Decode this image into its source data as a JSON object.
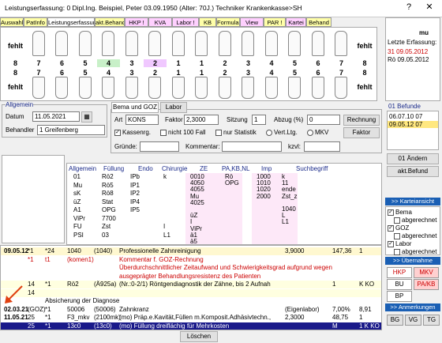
{
  "title": "Leistungserfassung: 0  Dipl.Ing. Beispiel, Peter  03.09.1950 (Alter: 70J.)  Techniker Krankenkasse>SH",
  "window": {
    "help": "?",
    "close": "✕"
  },
  "tabs": [
    "Auswahl",
    "PatInfo",
    "Leistungserfassung !",
    "akt.Behand",
    "HKP !",
    "KVA",
    "Labor !",
    "KB",
    "Formular",
    "View",
    "PAR !",
    "Kartei",
    "Behand"
  ],
  "tab_colors": [
    "#ffffa8",
    "#ffffa8",
    "#ffffff",
    "#ffffa8",
    "#ffd0ff",
    "#ffd0ff",
    "#ffd0ff",
    "#ffffa8",
    "#ffffa8",
    "#ffd0ff",
    "#ffffa8",
    "#ffd0ff",
    "#ffffa8"
  ],
  "teeth": {
    "upper": [
      "fehlt",
      "",
      "",
      "",
      "",
      "",
      "",
      "",
      "",
      "",
      "",
      "",
      "",
      "",
      "",
      "fehlt"
    ],
    "upper_nums": [
      "8",
      "7",
      "6",
      "5",
      "4",
      "3",
      "2",
      "1",
      "1",
      "2",
      "3",
      "4",
      "5",
      "6",
      "7",
      "8"
    ],
    "lower_nums": [
      "8",
      "7",
      "6",
      "5",
      "4",
      "3",
      "2",
      "1",
      "1",
      "2",
      "3",
      "4",
      "5",
      "6",
      "7",
      "8"
    ],
    "lower": [
      "fehlt",
      "",
      "",
      "",
      "",
      "",
      "",
      "",
      "",
      "",
      "",
      "",
      "",
      "",
      "",
      "fehlt"
    ]
  },
  "rightpanel": {
    "letzte": "Letzte Erfassung:",
    "d1": "31 09.05.2012",
    "d2": "Rö 09.05.2012",
    "mu": "mu"
  },
  "allgemein": {
    "title": "Allgemein",
    "datum_label": "Datum",
    "datum": "11.05.2021",
    "behandler_label": "Behandler",
    "behandler": "1 Greifenberg"
  },
  "bema": {
    "tab1": "Bema und GOZ",
    "tab2": "Labor",
    "art_label": "Art",
    "art": "KONS",
    "faktor_label": "Faktor",
    "faktor": "2,3000",
    "sitzung_label": "Sitzung",
    "sitzung": "1",
    "abzug_label": "Abzug (%)",
    "abzug": "0",
    "rechnung": "Rechnung",
    "faktor_btn": "Faktor",
    "kassenrg": "Kassenrg.",
    "nicht100": "nicht 100 Fall",
    "statistik": "nur Statistik",
    "vertltg": "Vert.Ltg.",
    "mkv": "MKV",
    "gruende_label": "Gründe:",
    "kommentar_label": "Kommentar:",
    "kzvl_label": "kzvl:"
  },
  "befunde": {
    "title": "01 Befunde",
    "items": [
      "06.07.10 07",
      "09.05.12 07"
    ],
    "aendern": "01 Ändern",
    "akt": "akt.Befund"
  },
  "grid": {
    "headers": [
      "Allgemein",
      "Füllung",
      "Endo",
      "Chirurgie",
      "ZE",
      "PA,KB,NL",
      "Imp",
      "Suchbegriff"
    ],
    "col1": [
      "01",
      "Mu",
      "sK",
      "üZ",
      "A1",
      "ViPr",
      "FU",
      "PSI"
    ],
    "col2": [
      "Rö2",
      "Rö5",
      "Rö8",
      "Stat",
      "OPG",
      "7700",
      "Zst",
      "03"
    ],
    "col3": [
      "IPb",
      "IP1",
      "IP2",
      "IP4",
      "IP5",
      "",
      "",
      ""
    ],
    "col4": [
      "k",
      "",
      "",
      "",
      "",
      "",
      "I",
      "L1"
    ],
    "col5": [
      "0010",
      "4050",
      "4055",
      "Mu",
      "4025",
      "",
      "",
      "",
      "",
      "",
      ""
    ],
    "col5b": [
      "0010",
      "4050",
      "4055",
      "Mu",
      "4025",
      "",
      "üZ",
      "I",
      "ViPr",
      "ä1",
      "ä5"
    ],
    "col6": [
      "Rö",
      "OPG",
      "",
      "",
      "",
      "",
      "",
      "",
      "",
      "",
      ""
    ],
    "col7": [
      "1000",
      "1010",
      "1020",
      "2000",
      "",
      "",
      "",
      "",
      "",
      "",
      ""
    ],
    "col8": [
      "k",
      "11",
      "ende",
      "Zst_z",
      "",
      "",
      "",
      "",
      "",
      "",
      ""
    ],
    "col8b": [
      "",
      "",
      "",
      "",
      "",
      "1040",
      "L",
      "L1",
      "",
      "",
      ""
    ]
  },
  "list": {
    "rows": [
      {
        "date": "09.05.12",
        "n": "*1",
        "code": "*24",
        "c2": "1040",
        "c3": "(1040)",
        "text": "Professionelle Zahnreinigung",
        "f": "3,9000",
        "v": "147,36",
        "k": "1",
        "color": "#000"
      },
      {
        "date": "",
        "n": "*1",
        "code": "t1",
        "c2": "(komen1)",
        "c3": "",
        "text": "Kommentar f. GOZ-Rechnung",
        "f": "",
        "v": "",
        "k": "",
        "color": "#c00"
      },
      {
        "date": "",
        "n": "",
        "code": "",
        "c2": "",
        "c3": "",
        "text": "Überdurchschnittlicher Zeitaufwand und Schwierigkeitsgrad aufgrund wegen",
        "f": "",
        "v": "",
        "k": "",
        "color": "#c00"
      },
      {
        "date": "",
        "n": "",
        "code": "",
        "c2": "",
        "c3": "",
        "text": "ausgeprägter Behandlungsresistenz des Patienten",
        "f": "",
        "v": "",
        "k": "",
        "color": "#c00"
      },
      {
        "date": "",
        "n": "14",
        "code": "*1",
        "c2": "Rö2",
        "c3": "(Ä925a)",
        "text": "(Nr.:0-2/1) Röntgendiagnostik der Zähne, bis 2 Aufnah",
        "f": "",
        "v": "1",
        "k": "K KO",
        "color": "#000"
      },
      {
        "date": "",
        "n": "14",
        "code": "",
        "c2": "",
        "c3": "",
        "text": "",
        "f": "",
        "v": "",
        "k": "",
        "color": "#000"
      },
      {
        "date": "",
        "n": "",
        "code": "Absicherung der Diagnose",
        "c2": "",
        "c3": "",
        "text": "",
        "f": "",
        "v": "",
        "k": "",
        "color": "#000"
      },
      {
        "date": "02.03.21",
        "n": "(GOZ)",
        "code": "*1",
        "c2": "50006",
        "c3": "(50006)",
        "text": "Zahnkranz",
        "f": "(Eigenlabor)",
        "v": "7,00%",
        "k": "8,91",
        "color": "#000"
      },
      {
        "date": "11.05.21",
        "n": "25",
        "code": "*1",
        "c2": "F3_mkv",
        "c3": "(2100mk)",
        "text": "(mo) Präp.e.Kavität,Füllen m.Komposit.Adhäsivtechn.,",
        "f": "2,3000",
        "v": "48,75",
        "k": "1",
        "color": "#000"
      },
      {
        "date": "",
        "n": "25",
        "code": "*1",
        "c2": "13c0",
        "c3": "(13c0)",
        "text": "(mo) Füllung dreiflächig für Mehrkosten",
        "f": "",
        "v": "M",
        "k": "1 K KO",
        "color": "#fff"
      }
    ]
  },
  "loeschen": "Löschen",
  "karteiansicht": {
    "title": ">> Karteiansicht",
    "items": [
      "Bema",
      "abgerechnet",
      "GOZ",
      "abgerechnet",
      "Labor",
      "abgerechnet"
    ]
  },
  "uebernahme": {
    "title": ">> Übernahme",
    "btns": [
      "HKP",
      "MKV",
      "BU",
      "PA/KB",
      "BP"
    ]
  },
  "anmerkungen": {
    "title": ">> Anmerkungen",
    "btns": [
      "BG",
      "VG",
      "TG"
    ]
  }
}
